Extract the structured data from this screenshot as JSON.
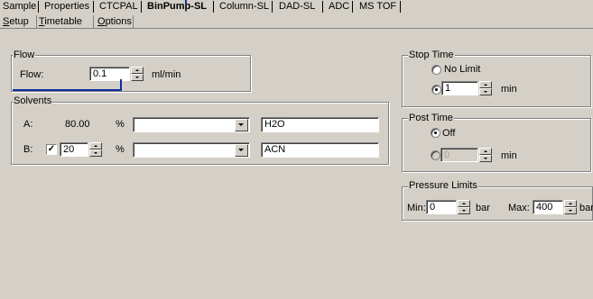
{
  "tabs": [
    "Sample",
    "Properties",
    "CTCPAL",
    "BinPump-SL",
    "Column-SL",
    "DAD-SL",
    "ADC",
    "MS TOF"
  ],
  "active_tab": "BinPump-SL",
  "subtabs": [
    {
      "label": "Setup",
      "key": "S",
      "rest": "etup"
    },
    {
      "label": "Timetable",
      "key": "T",
      "rest": "imetable"
    },
    {
      "label": "Options",
      "key": "O",
      "rest": "ptions"
    }
  ],
  "flow": {
    "title": "Flow",
    "label": "Flow:",
    "value": "0.1",
    "unit": "ml/min"
  },
  "solvents": {
    "title": "Solvents",
    "a": {
      "label": "A:",
      "percent": "80.00",
      "pct_symbol": "%",
      "name": "H2O"
    },
    "b": {
      "label": "B:",
      "checked": "✓",
      "percent": "20",
      "pct_symbol": "%",
      "name": "ACN"
    }
  },
  "stop_time": {
    "title": "Stop Time",
    "no_limit": "No Limit",
    "value": "1",
    "unit": "min"
  },
  "post_time": {
    "title": "Post Time",
    "off": "Off",
    "value": "0",
    "unit": "min"
  },
  "pressure": {
    "title": "Pressure Limits",
    "min_label": "Min:",
    "min_value": "0",
    "min_unit": "bar",
    "max_label": "Max:",
    "max_value": "400",
    "max_unit": "bar"
  },
  "colors": {
    "callout": "#0b2ea0",
    "background": "#d4d0c8"
  }
}
